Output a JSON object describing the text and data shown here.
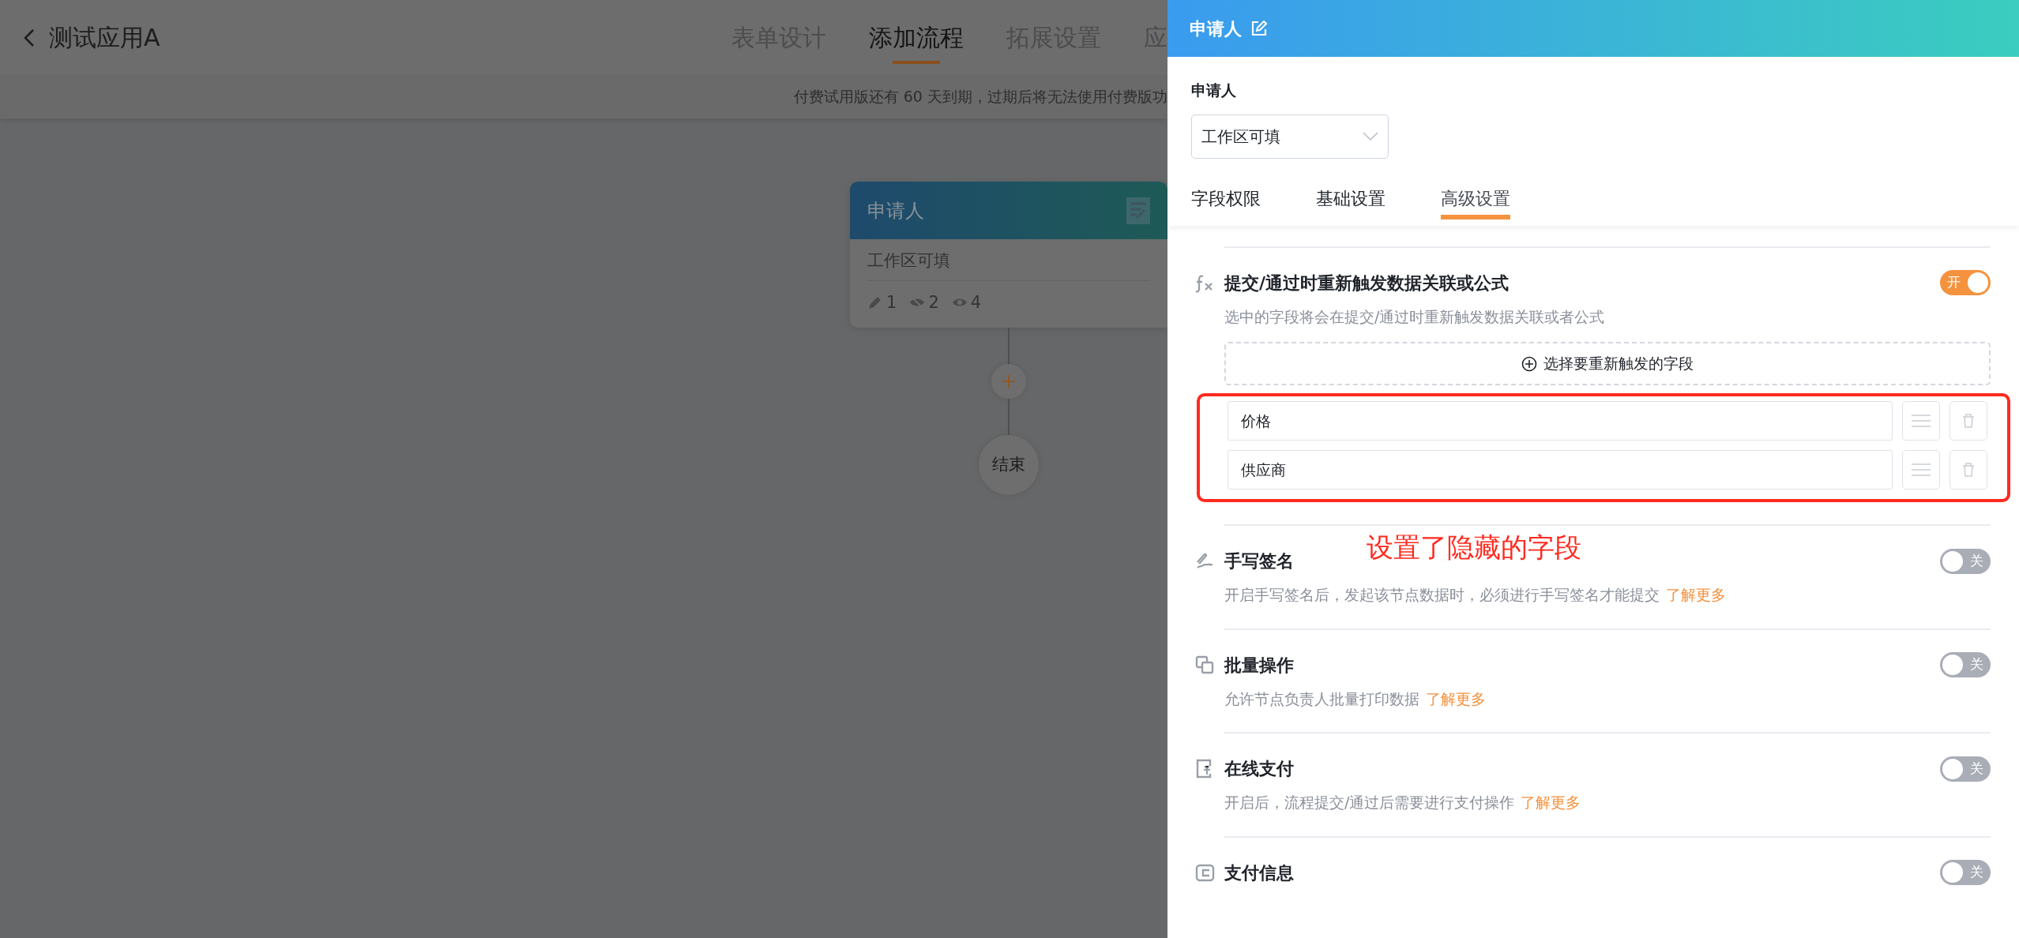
{
  "app": {
    "title": "测试应用A",
    "tabs": [
      {
        "label": "表单设计",
        "selected": false
      },
      {
        "label": "添加流程",
        "selected": true
      },
      {
        "label": "拓展设置",
        "selected": false
      },
      {
        "label": "应",
        "selected": false
      }
    ],
    "notice": "付费试用版还有 60 天到期，过期后将无法使用付费版功"
  },
  "flow": {
    "node": {
      "title": "申请人",
      "subtitle": "工作区可填",
      "counts": [
        {
          "kind": "edit",
          "value": "1"
        },
        {
          "kind": "hidden",
          "value": "2"
        },
        {
          "kind": "visible",
          "value": "4"
        }
      ]
    },
    "end": "结束"
  },
  "panel": {
    "title": "申请人",
    "field_label": "申请人",
    "select_value": "工作区可填",
    "tabs": [
      {
        "label": "字段权限",
        "selected": false
      },
      {
        "label": "基础设置",
        "selected": false
      },
      {
        "label": "高级设置",
        "selected": true
      }
    ],
    "sections": [
      {
        "title": "提交/通过时重新触发数据关联或公式",
        "description": "选中的字段将会在提交/通过时重新触发数据关联或者公式",
        "on": true,
        "toggle_label": "开",
        "add_button": "选择要重新触发的字段",
        "fields": [
          "价格",
          "供应商"
        ]
      },
      {
        "title": "手写签名",
        "description": "开启手写签名后，发起该节点数据时，必须进行手写签名才能提交",
        "link": "了解更多",
        "on": false,
        "toggle_label": "关"
      },
      {
        "title": "批量操作",
        "description": "允许节点负责人批量打印数据",
        "link": "了解更多",
        "on": false,
        "toggle_label": "关"
      },
      {
        "title": "在线支付",
        "description": "开启后，流程提交/通过后需要进行支付操作",
        "link": "了解更多",
        "on": false,
        "toggle_label": "关"
      },
      {
        "title": "支付信息",
        "on": false,
        "toggle_label": "关"
      }
    ]
  },
  "annotation": {
    "text": "设置了隐藏的字段"
  }
}
